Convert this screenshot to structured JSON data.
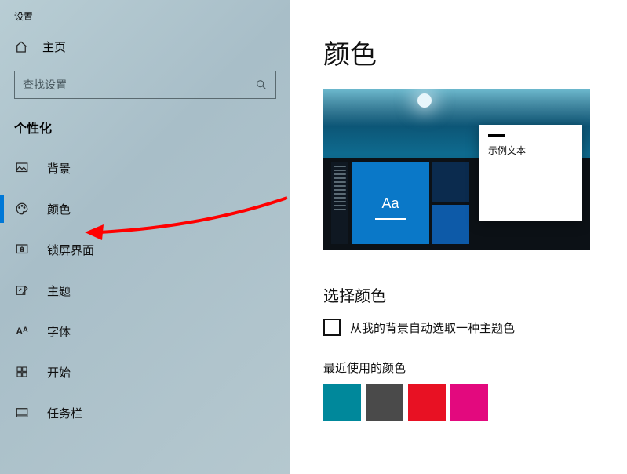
{
  "app": {
    "title": "设置"
  },
  "sidebar": {
    "home_label": "主页",
    "search_placeholder": "查找设置",
    "section_title": "个性化",
    "items": [
      {
        "label": "背景"
      },
      {
        "label": "颜色"
      },
      {
        "label": "锁屏界面"
      },
      {
        "label": "主题"
      },
      {
        "label": "字体"
      },
      {
        "label": "开始"
      },
      {
        "label": "任务栏"
      }
    ],
    "selected_index": 1
  },
  "main": {
    "page_title": "颜色",
    "preview": {
      "sample_text": "示例文本",
      "aa": "Aa"
    },
    "choose_color_title": "选择颜色",
    "auto_checkbox_label": "从我的背景自动选取一种主题色",
    "auto_checked": false,
    "recent_title": "最近使用的颜色",
    "recent_colors": [
      "#00889b",
      "#4a4a4a",
      "#e81123",
      "#e3097e"
    ]
  }
}
